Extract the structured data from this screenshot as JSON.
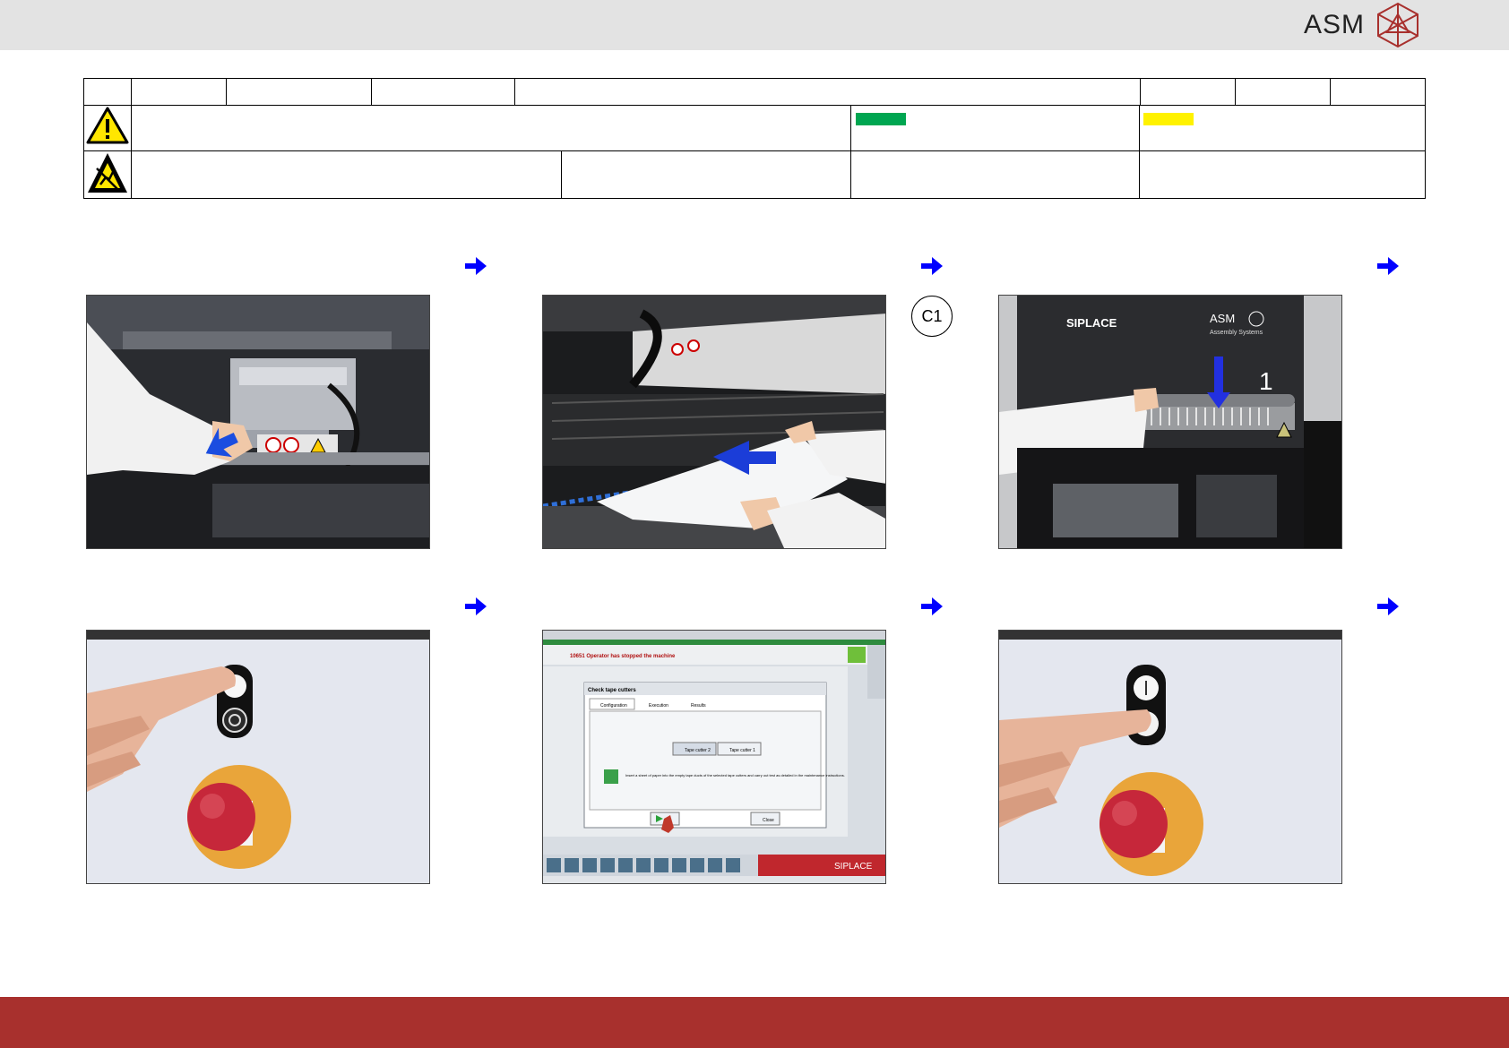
{
  "brand": {
    "logo_text": "ASM",
    "bar_gray": "#e3e3e3",
    "bar_red": "#a8302d",
    "accent_blue": "#0000ff"
  },
  "header_table": {
    "status_green": "#00a651",
    "status_yellow": "#fff200",
    "warning_icon": "warning-triangle-icon",
    "esd_icon": "esd-sensitive-icon"
  },
  "steps": {
    "callout_label": "C1",
    "arrow_icon": "arrow-right-icon",
    "photo_3_overlay_number": "1"
  },
  "screenshot_photo": {
    "window_title": "Check tape cutters",
    "error_text": "10651 Operator has stopped the machine",
    "tabs": [
      "Configuration",
      "Execution",
      "Results"
    ],
    "tape_cutter_buttons": [
      "Tape cutter 2",
      "Tape cutter 1"
    ],
    "instruction": "Insert a sheet of paper into the empty tape ducts of the selected tape cutters and carry out test as detailed in the maintenance instructions.",
    "close_label": "Close",
    "brand": "SIPLACE"
  },
  "machine_photo": {
    "brand_left": "SIPLACE",
    "brand_right": "ASM",
    "brand_right_sub": "Assembly Systems"
  }
}
